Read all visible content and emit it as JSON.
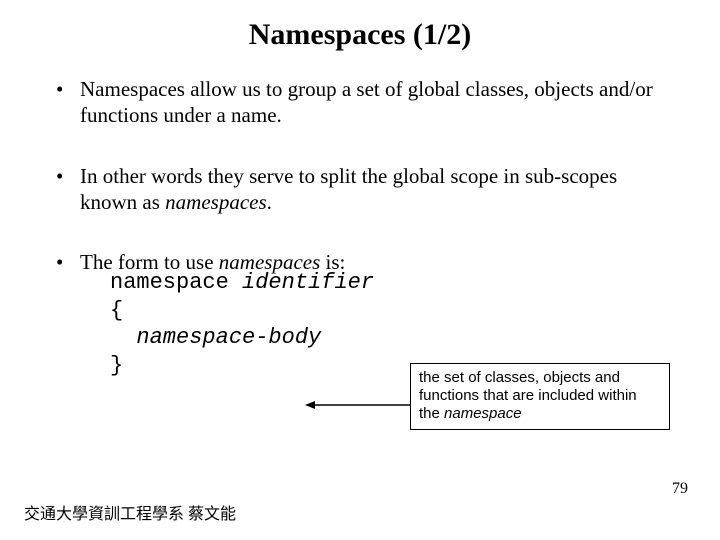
{
  "title": "Namespaces (1/2)",
  "bullets": {
    "b1": "Namespaces allow us to group a set of global classes, objects and/or functions under a name.",
    "b2a": "In other words they serve to split the global scope in sub-scopes known as ",
    "b2b": "namespaces",
    "b2c": ".",
    "b3a": "The form to use ",
    "b3b": "namespaces",
    "b3c": " is:"
  },
  "code": {
    "l1a": "namespace ",
    "l1b": "identifier",
    "l2": "{",
    "l3a": "  ",
    "l3b": "namespace-body",
    "l4": "}"
  },
  "callout": {
    "t1": "the set of classes, objects and functions that are included within the ",
    "t2": "namespace"
  },
  "footer": "交通大學資訓工程學系 蔡文能",
  "page": "79"
}
